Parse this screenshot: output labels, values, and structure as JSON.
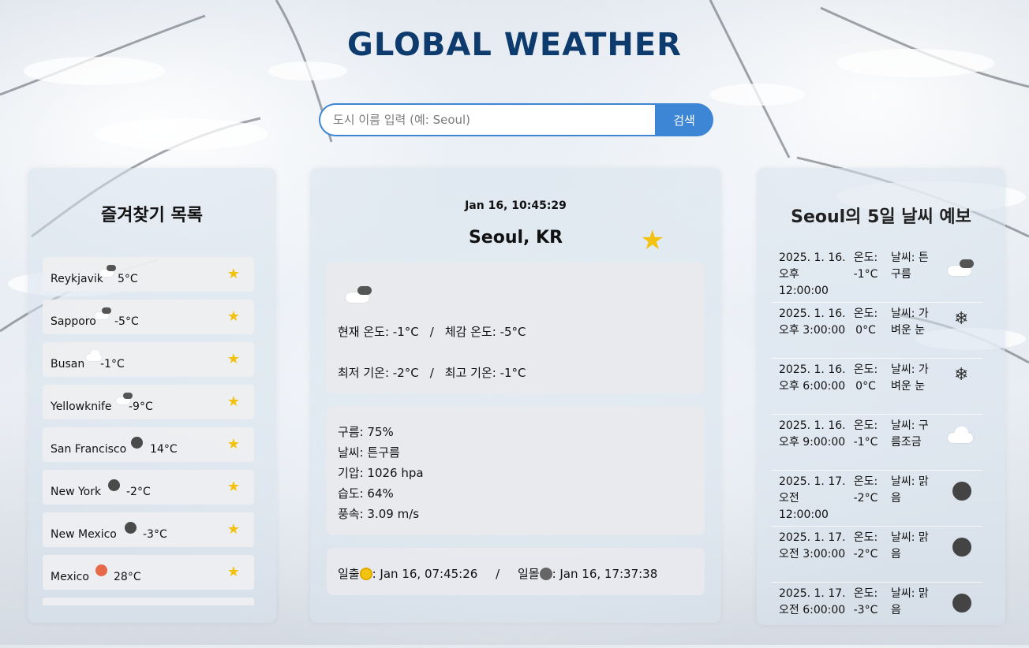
{
  "header": {
    "title": "GLOBAL WEATHER"
  },
  "search": {
    "placeholder": "도시 이름 입력 (예: Seoul)",
    "button_label": "검색"
  },
  "favorites": {
    "title": "즐겨찾기 목록",
    "items": [
      {
        "city": "Reykjavik",
        "temp": "5°C",
        "icon": "cloud-dark-icon"
      },
      {
        "city": "Sapporo",
        "temp": "-5°C",
        "icon": "cloud-dark-icon"
      },
      {
        "city": "Busan",
        "temp": "-1°C",
        "icon": "cloud-icon"
      },
      {
        "city": "Yellowknife",
        "temp": "-9°C",
        "icon": "cloud-dark-icon"
      },
      {
        "city": "San Francisco",
        "temp": "14°C",
        "icon": "moon-icon"
      },
      {
        "city": "New York",
        "temp": "-2°C",
        "icon": "moon-icon"
      },
      {
        "city": "New Mexico",
        "temp": "-3°C",
        "icon": "moon-icon"
      },
      {
        "city": "Mexico",
        "temp": "28°C",
        "icon": "sun-icon"
      }
    ],
    "star_glyph": "★"
  },
  "current": {
    "datetime": "Jan 16, 10:45:29",
    "city": "Seoul, KR",
    "star_glyph": "★",
    "temp_line": {
      "current": "현재 온도: -1°C",
      "sep": "/",
      "feels": "체감 온도: -5°C"
    },
    "minmax_line": {
      "min": "최저 기온: -2°C",
      "sep": "/",
      "max": "최고 기온: -1°C"
    },
    "details": {
      "clouds": "구름: 75%",
      "weather": "날씨: 튼구름",
      "pressure": "기압: 1026 hpa",
      "humidity": "습도: 64%",
      "wind": "풍속: 3.09 m/s"
    },
    "sun": {
      "sunrise_label": "일출",
      "sunrise_time": ": Jan 16, 07:45:26",
      "sep": "/",
      "sunset_label": "일몰",
      "sunset_time": ": Jan 16, 17:37:38"
    }
  },
  "forecast": {
    "title": "Seoul의 5일 날씨 예보",
    "rows": [
      {
        "date": "2025. 1. 16. 오후 12:00:00",
        "temp": "온도: -1°C",
        "weather": "날씨: 튼구름",
        "icon": "cloud-dark-icon"
      },
      {
        "date": "2025. 1. 16. 오후 3:00:00",
        "temp": "온도: 0°C",
        "weather": "날씨: 가벼운 눈",
        "icon": "snowflake-icon"
      },
      {
        "date": "2025. 1. 16. 오후 6:00:00",
        "temp": "온도: 0°C",
        "weather": "날씨: 가벼운 눈",
        "icon": "snowflake-icon"
      },
      {
        "date": "2025. 1. 16. 오후 9:00:00",
        "temp": "온도: -1°C",
        "weather": "날씨: 구름조금",
        "icon": "cloud-icon"
      },
      {
        "date": "2025. 1. 17. 오전 12:00:00",
        "temp": "온도: -2°C",
        "weather": "날씨: 맑음",
        "icon": "moon-icon"
      },
      {
        "date": "2025. 1. 17. 오전 3:00:00",
        "temp": "온도: -2°C",
        "weather": "날씨: 맑음",
        "icon": "moon-icon"
      },
      {
        "date": "2025. 1. 17. 오전 6:00:00",
        "temp": "온도: -3°C",
        "weather": "날씨: 맑음",
        "icon": "moon-icon"
      }
    ]
  },
  "colors": {
    "title": "#0d3b6e",
    "accent": "#3d86d6",
    "star": "#f2c20f"
  }
}
